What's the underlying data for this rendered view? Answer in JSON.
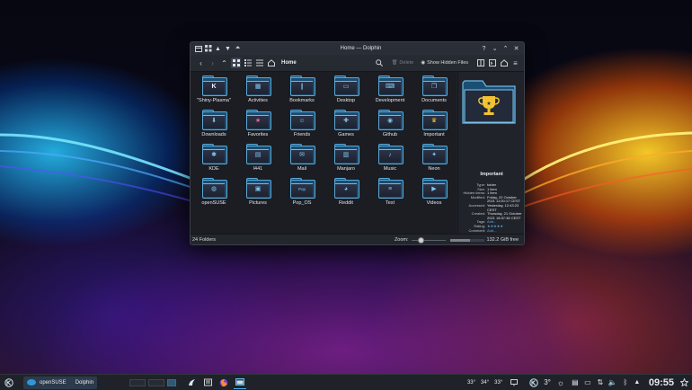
{
  "window": {
    "title": "Home — Dolphin",
    "help_label": "?",
    "breadcrumb": "Home",
    "delete_label": "Delete",
    "hidden_files_label": "Show Hidden Files"
  },
  "folders": [
    {
      "label": "\"Shiny-Plasma\"",
      "icon": "kde-logo-icon",
      "glyph": "K"
    },
    {
      "label": "Activities",
      "icon": "activities-icon",
      "glyph": "▦"
    },
    {
      "label": "Bookmarks",
      "icon": "bookmark-icon",
      "glyph": "❙"
    },
    {
      "label": "Desktop",
      "icon": "desktop-icon",
      "glyph": "▭"
    },
    {
      "label": "Development",
      "icon": "development-icon",
      "glyph": "⌨"
    },
    {
      "label": "Documents",
      "icon": "documents-icon",
      "glyph": "❐"
    },
    {
      "label": "Downloads",
      "icon": "download-icon",
      "glyph": "⬇"
    },
    {
      "label": "Favorites",
      "icon": "star-icon",
      "glyph": "★"
    },
    {
      "label": "Friends",
      "icon": "people-icon",
      "glyph": "☺"
    },
    {
      "label": "Games",
      "icon": "gamepad-icon",
      "glyph": "✚"
    },
    {
      "label": "Github",
      "icon": "github-icon",
      "glyph": "◉"
    },
    {
      "label": "Important",
      "icon": "trophy-icon",
      "glyph": "♛"
    },
    {
      "label": "KDE",
      "icon": "kde-icon",
      "glyph": "✱"
    },
    {
      "label": "l441",
      "icon": "folder-icon",
      "glyph": "▤"
    },
    {
      "label": "Mail",
      "icon": "mail-icon",
      "glyph": "✉"
    },
    {
      "label": "Manjaro",
      "icon": "manjaro-icon",
      "glyph": "▥"
    },
    {
      "label": "Music",
      "icon": "music-icon",
      "glyph": "♪"
    },
    {
      "label": "Neon",
      "icon": "neon-icon",
      "glyph": "✦"
    },
    {
      "label": "openSUSE",
      "icon": "opensuse-icon",
      "glyph": "◍"
    },
    {
      "label": "Pictures",
      "icon": "picture-icon",
      "glyph": "▣"
    },
    {
      "label": "Pop_OS",
      "icon": "popos-icon",
      "glyph": "Pop"
    },
    {
      "label": "Reddit",
      "icon": "reddit-icon",
      "glyph": "◕"
    },
    {
      "label": "Text",
      "icon": "text-icon",
      "glyph": "≡"
    },
    {
      "label": "Videos",
      "icon": "video-icon",
      "glyph": "▶"
    }
  ],
  "info": {
    "title": "Important",
    "rows": [
      {
        "k": "Type:",
        "v": "folder"
      },
      {
        "k": "Size:",
        "v": "1 item"
      },
      {
        "k": "Hidden items:",
        "v": "1 item"
      },
      {
        "k": "Modified:",
        "v": "Friday, 22 October 2021 11:00:17 CEST"
      },
      {
        "k": "Accessed:",
        "v": "Yesterday, 12:43:23 CEST"
      },
      {
        "k": "Created:",
        "v": "Thursday, 21 October 2021 18:57:38 CEST"
      },
      {
        "k": "Tags:",
        "v": "Add..."
      },
      {
        "k": "Rating:",
        "v": "★★★★★"
      },
      {
        "k": "Comment:",
        "v": "Add..."
      }
    ]
  },
  "statusbar": {
    "count": "24 Folders",
    "zoom_label": "Zoom:",
    "free_space": "132.2 GiB free",
    "free_fraction": 0.6
  },
  "panel": {
    "distro_label": "openSUSE",
    "app_label": "Dolphin",
    "temps": [
      "33°",
      "34°",
      "33°"
    ],
    "weather_temp": "3°",
    "clock": "09:55"
  },
  "colors": {
    "accent": "#3daee9",
    "window_bg": "#20232a",
    "folder_outline": "#5aa8d6"
  }
}
